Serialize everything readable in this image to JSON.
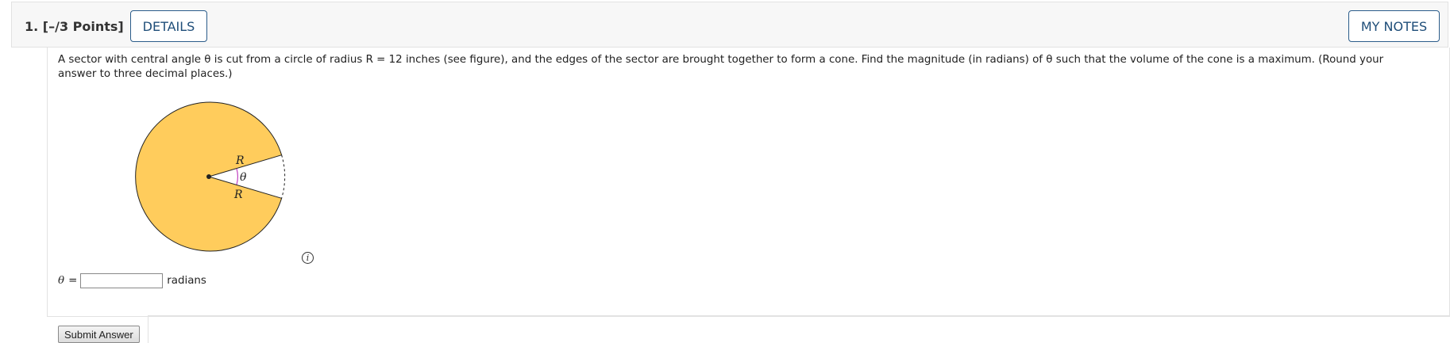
{
  "question": {
    "number_points": "1. [–/3 Points]",
    "details_label": "DETAILS",
    "notes_label": "MY NOTES"
  },
  "problem": {
    "text": "A sector with central angle θ is cut from a circle of radius R = 12 inches (see figure), and the edges of the sector are brought together to form a cone. Find the magnitude (in radians) of θ such that the volume of the cone is a maximum. (Round your answer to three decimal places.)"
  },
  "figure": {
    "label_r_top": "R",
    "label_r_bottom": "R",
    "label_theta": "θ",
    "fill_color": "#ffcc5c",
    "info_symbol": "i"
  },
  "answer": {
    "variable": "θ",
    "equals": "=",
    "value": "",
    "unit": "radians"
  },
  "submit_label": "Submit Answer",
  "colors": {
    "button_border": "#2b5c8a",
    "button_text": "#1f4e79",
    "theta_arc": "#c040c0"
  }
}
